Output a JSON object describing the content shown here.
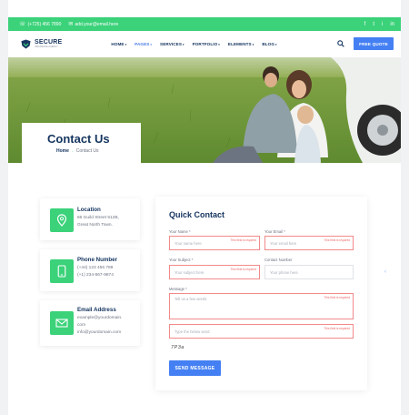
{
  "window": {
    "dots": 3
  },
  "topbar": {
    "phone": "(+725) 456 7890",
    "email": "add.your@email.here",
    "socials": [
      "f",
      "t",
      "i",
      "in"
    ]
  },
  "nav": {
    "logo_name": "SECURE",
    "logo_tagline": "INSURANCE AGENCY",
    "menu": [
      "HOME",
      "PAGES",
      "SERVICES",
      "PORTFOLIO",
      "ELEMENTS",
      "BLOG"
    ],
    "active_index": 1,
    "quote_label": "FREE QUOTE"
  },
  "hero": {
    "title": "Contact Us",
    "crumb_home": "Home",
    "crumb_sep": "•",
    "crumb_current": "Contact Us"
  },
  "info_cards": [
    {
      "icon": "map-pin-icon",
      "title": "Location",
      "lines": [
        "66 Guild Street 512B,",
        "Great North Town."
      ]
    },
    {
      "icon": "phone-icon",
      "title": "Phone Number",
      "lines": [
        "(+44) 123 456 789",
        "(+1) 234-567-9874"
      ]
    },
    {
      "icon": "envelope-icon",
      "title": "Email Address",
      "lines": [
        "example@yourdomain.",
        "com",
        "info@yourdomain.com"
      ]
    }
  ],
  "form": {
    "title": "Quick Contact",
    "name_label": "Your Name *",
    "name_placeholder": "Your name here",
    "email_label": "Your Email *",
    "email_placeholder": "Your email here",
    "subject_label": "Your Subject *",
    "subject_placeholder": "Your subject here",
    "contact_label": "Contact Number",
    "contact_placeholder": "Your phone here",
    "message_label": "Message *",
    "message_placeholder": "Tell us a few words",
    "captcha_placeholder": "Type the below word",
    "captcha_word": "7P3a",
    "required_note": "This field is required",
    "send_label": "SEND MESSAGE"
  },
  "colors": {
    "brand_green": "#3bd27a",
    "navy": "#173660",
    "accent_blue": "#4480f3",
    "error_red": "#f06565"
  }
}
